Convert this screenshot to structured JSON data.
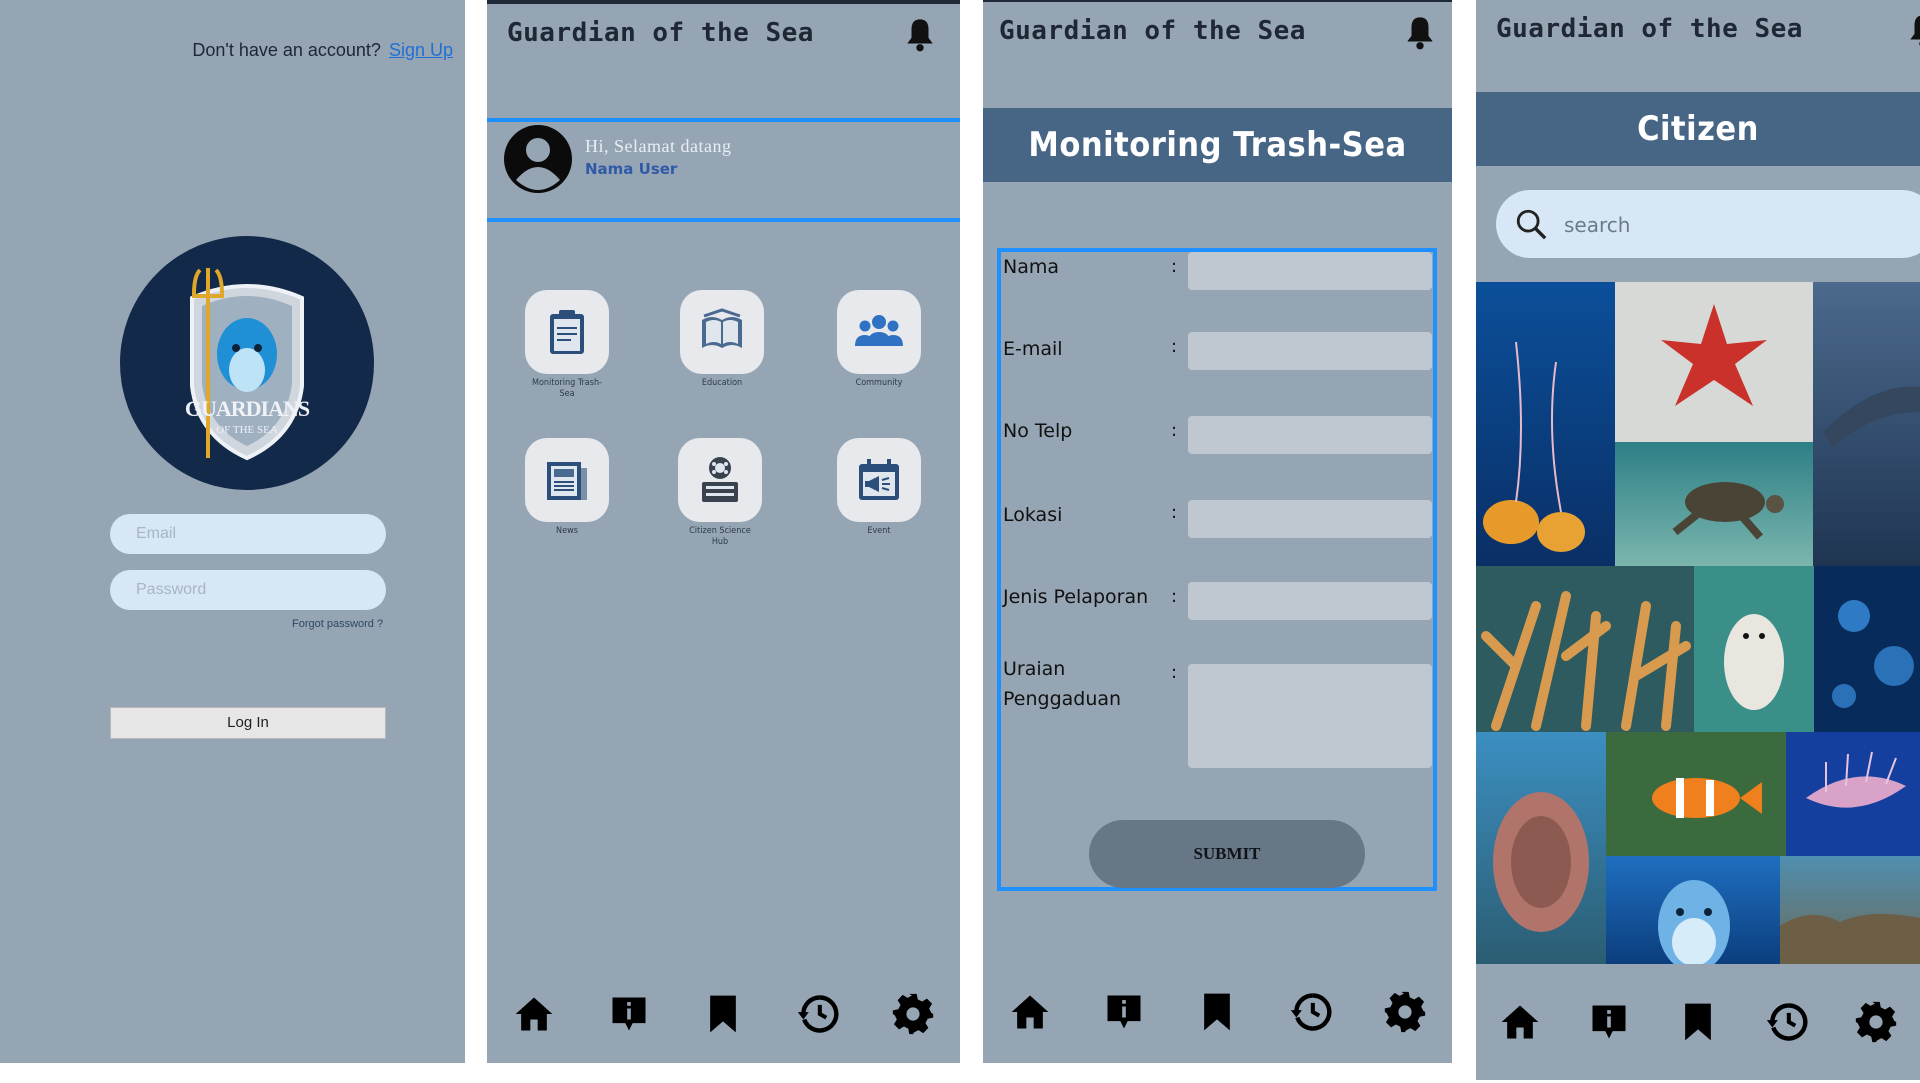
{
  "app": {
    "title": "Guardian of the Sea"
  },
  "login": {
    "prompt": "Don't have an account?",
    "signup_link": "Sign Up",
    "logo_text_main": "GUARDIANS",
    "logo_text_sub": "OF THE SEA",
    "email_placeholder": "Email",
    "password_placeholder": "Password",
    "forgot_password": "Forgot password ?",
    "login_button": "Log In"
  },
  "home": {
    "greeting": "Hi, Selamat datang",
    "user_name": "Nama User",
    "menu": [
      {
        "label": "Monitoring Trash-Sea",
        "icon": "clipboard-icon"
      },
      {
        "label": "Education",
        "icon": "book-icon"
      },
      {
        "label": "Community",
        "icon": "community-icon"
      },
      {
        "label": "News",
        "icon": "newspaper-icon"
      },
      {
        "label": "Citizen Science Hub",
        "icon": "film-reel-icon"
      },
      {
        "label": "Event",
        "icon": "calendar-megaphone-icon"
      }
    ]
  },
  "report": {
    "title": "Monitoring Trash-Sea",
    "fields": [
      {
        "label": "Nama",
        "value": ""
      },
      {
        "label": "E-mail",
        "value": ""
      },
      {
        "label": "No Telp",
        "value": ""
      },
      {
        "label": "Lokasi",
        "value": ""
      },
      {
        "label": "Jenis Pelaporan",
        "value": ""
      },
      {
        "label": "Uraian Penggaduan",
        "value": ""
      }
    ],
    "colon": ":",
    "submit_button": "SUBMIT"
  },
  "citizen": {
    "title": "Citizen",
    "search_placeholder": "search",
    "gallery": [
      "jellyfish",
      "starfish",
      "dolphins",
      "sea-turtle",
      "coral",
      "seal",
      "blue-jellyfish",
      "anemone",
      "clownfish",
      "lionfish",
      "dolphin",
      "reef"
    ]
  },
  "bottom_nav": [
    "home-icon",
    "info-icon",
    "bookmark-icon",
    "history-icon",
    "settings-icon"
  ],
  "colors": {
    "panel_bg": "#95a5b4",
    "banner": "#476585",
    "accent_blue": "#1e90ff",
    "input_bg": "#d8e7f5",
    "logo_bg": "#13294a"
  }
}
